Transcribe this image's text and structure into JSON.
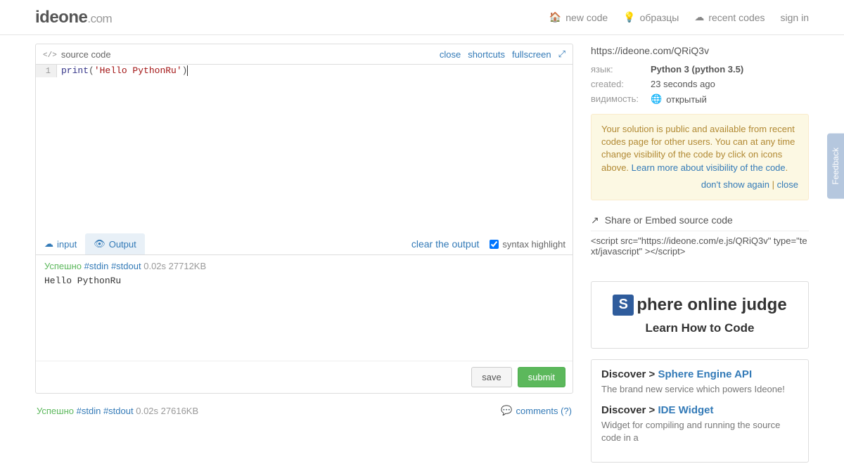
{
  "header": {
    "logo_main": "ideone",
    "logo_domain": ".com",
    "nav": {
      "new_code": "new code",
      "samples": "образцы",
      "recent": "recent codes",
      "signin": "sign in"
    }
  },
  "editor": {
    "title": "source code",
    "links": {
      "close": "close",
      "shortcuts": "shortcuts",
      "fullscreen": "fullscreen"
    },
    "code_line_no": "1",
    "code_kw": "print",
    "code_paren_open": "(",
    "code_str": "'Hello PythonRu'",
    "code_paren_close": ")"
  },
  "tabs": {
    "input": "input",
    "output": "Output",
    "clear": "clear the output",
    "syntax": "syntax highlight"
  },
  "output": {
    "status": "Успешно",
    "stdin": "#stdin",
    "stdout": "#stdout",
    "meta": "0.02s 27712KB",
    "text": "Hello PythonRu"
  },
  "actions": {
    "save": "save",
    "submit": "submit"
  },
  "summary": {
    "status": "Успешно",
    "stdin": "#stdin",
    "stdout": "#stdout",
    "meta": "0.02s 27616KB",
    "comments": "comments (?)"
  },
  "sidebar": {
    "url": "https://ideone.com/QRiQ3v",
    "meta": {
      "lang_label": "язык:",
      "lang_val": "Python 3 (python 3.5)",
      "created_label": "created:",
      "created_val": "23 seconds ago",
      "vis_label": "видимость:",
      "vis_val": "открытый"
    },
    "notice": {
      "text": "Your solution is public and available from recent codes page for other users. You can at any time change visibility of the code by click on icons above.",
      "learn": "Learn more about visibility of the code",
      "dont_show": "don't show again",
      "close": "close"
    },
    "share": {
      "title": "Share or Embed source code",
      "code": "<script src=\"https://ideone.com/e.js/QRiQ3v\" type=\"text/javascript\" ></script>"
    },
    "promo": {
      "logo": "phere online judge",
      "sub": "Learn How to Code"
    },
    "discover": {
      "d1_prefix": "Discover > ",
      "d1_link": "Sphere Engine API",
      "d1_text": "The brand new service which powers Ideone!",
      "d2_prefix": "Discover > ",
      "d2_link": "IDE Widget",
      "d2_text": "Widget for compiling and running the source code in a"
    }
  },
  "feedback": "Feedback"
}
